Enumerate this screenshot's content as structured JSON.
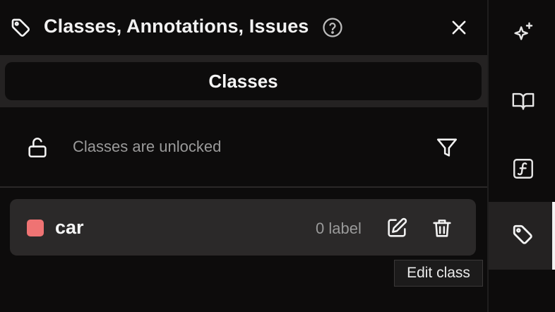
{
  "header": {
    "title": "Classes, Annotations, Issues",
    "icon": "tag-icon",
    "help_icon": "help-circle-icon",
    "close_icon": "close-icon"
  },
  "tabs": [
    {
      "label": "Classes",
      "active": true
    }
  ],
  "lock": {
    "status_text": "Classes are unlocked",
    "icon": "unlock-icon",
    "filter_icon": "filter-icon"
  },
  "classes": [
    {
      "name": "car",
      "color": "#ef7373",
      "label_count": "0 label",
      "edit_icon": "edit-icon",
      "delete_icon": "trash-icon"
    }
  ],
  "tooltip": {
    "text": "Edit class"
  },
  "rail": {
    "items": [
      {
        "icon": "sparkles-icon",
        "active": false
      },
      {
        "icon": "book-icon",
        "active": false
      },
      {
        "icon": "function-icon",
        "active": false
      },
      {
        "icon": "tag-icon",
        "active": true
      }
    ]
  },
  "colors": {
    "background": "#0d0c0c",
    "surface": "#242222",
    "row": "#2b2929",
    "text": "#f5f5f5",
    "muted": "#9a9a9a"
  }
}
